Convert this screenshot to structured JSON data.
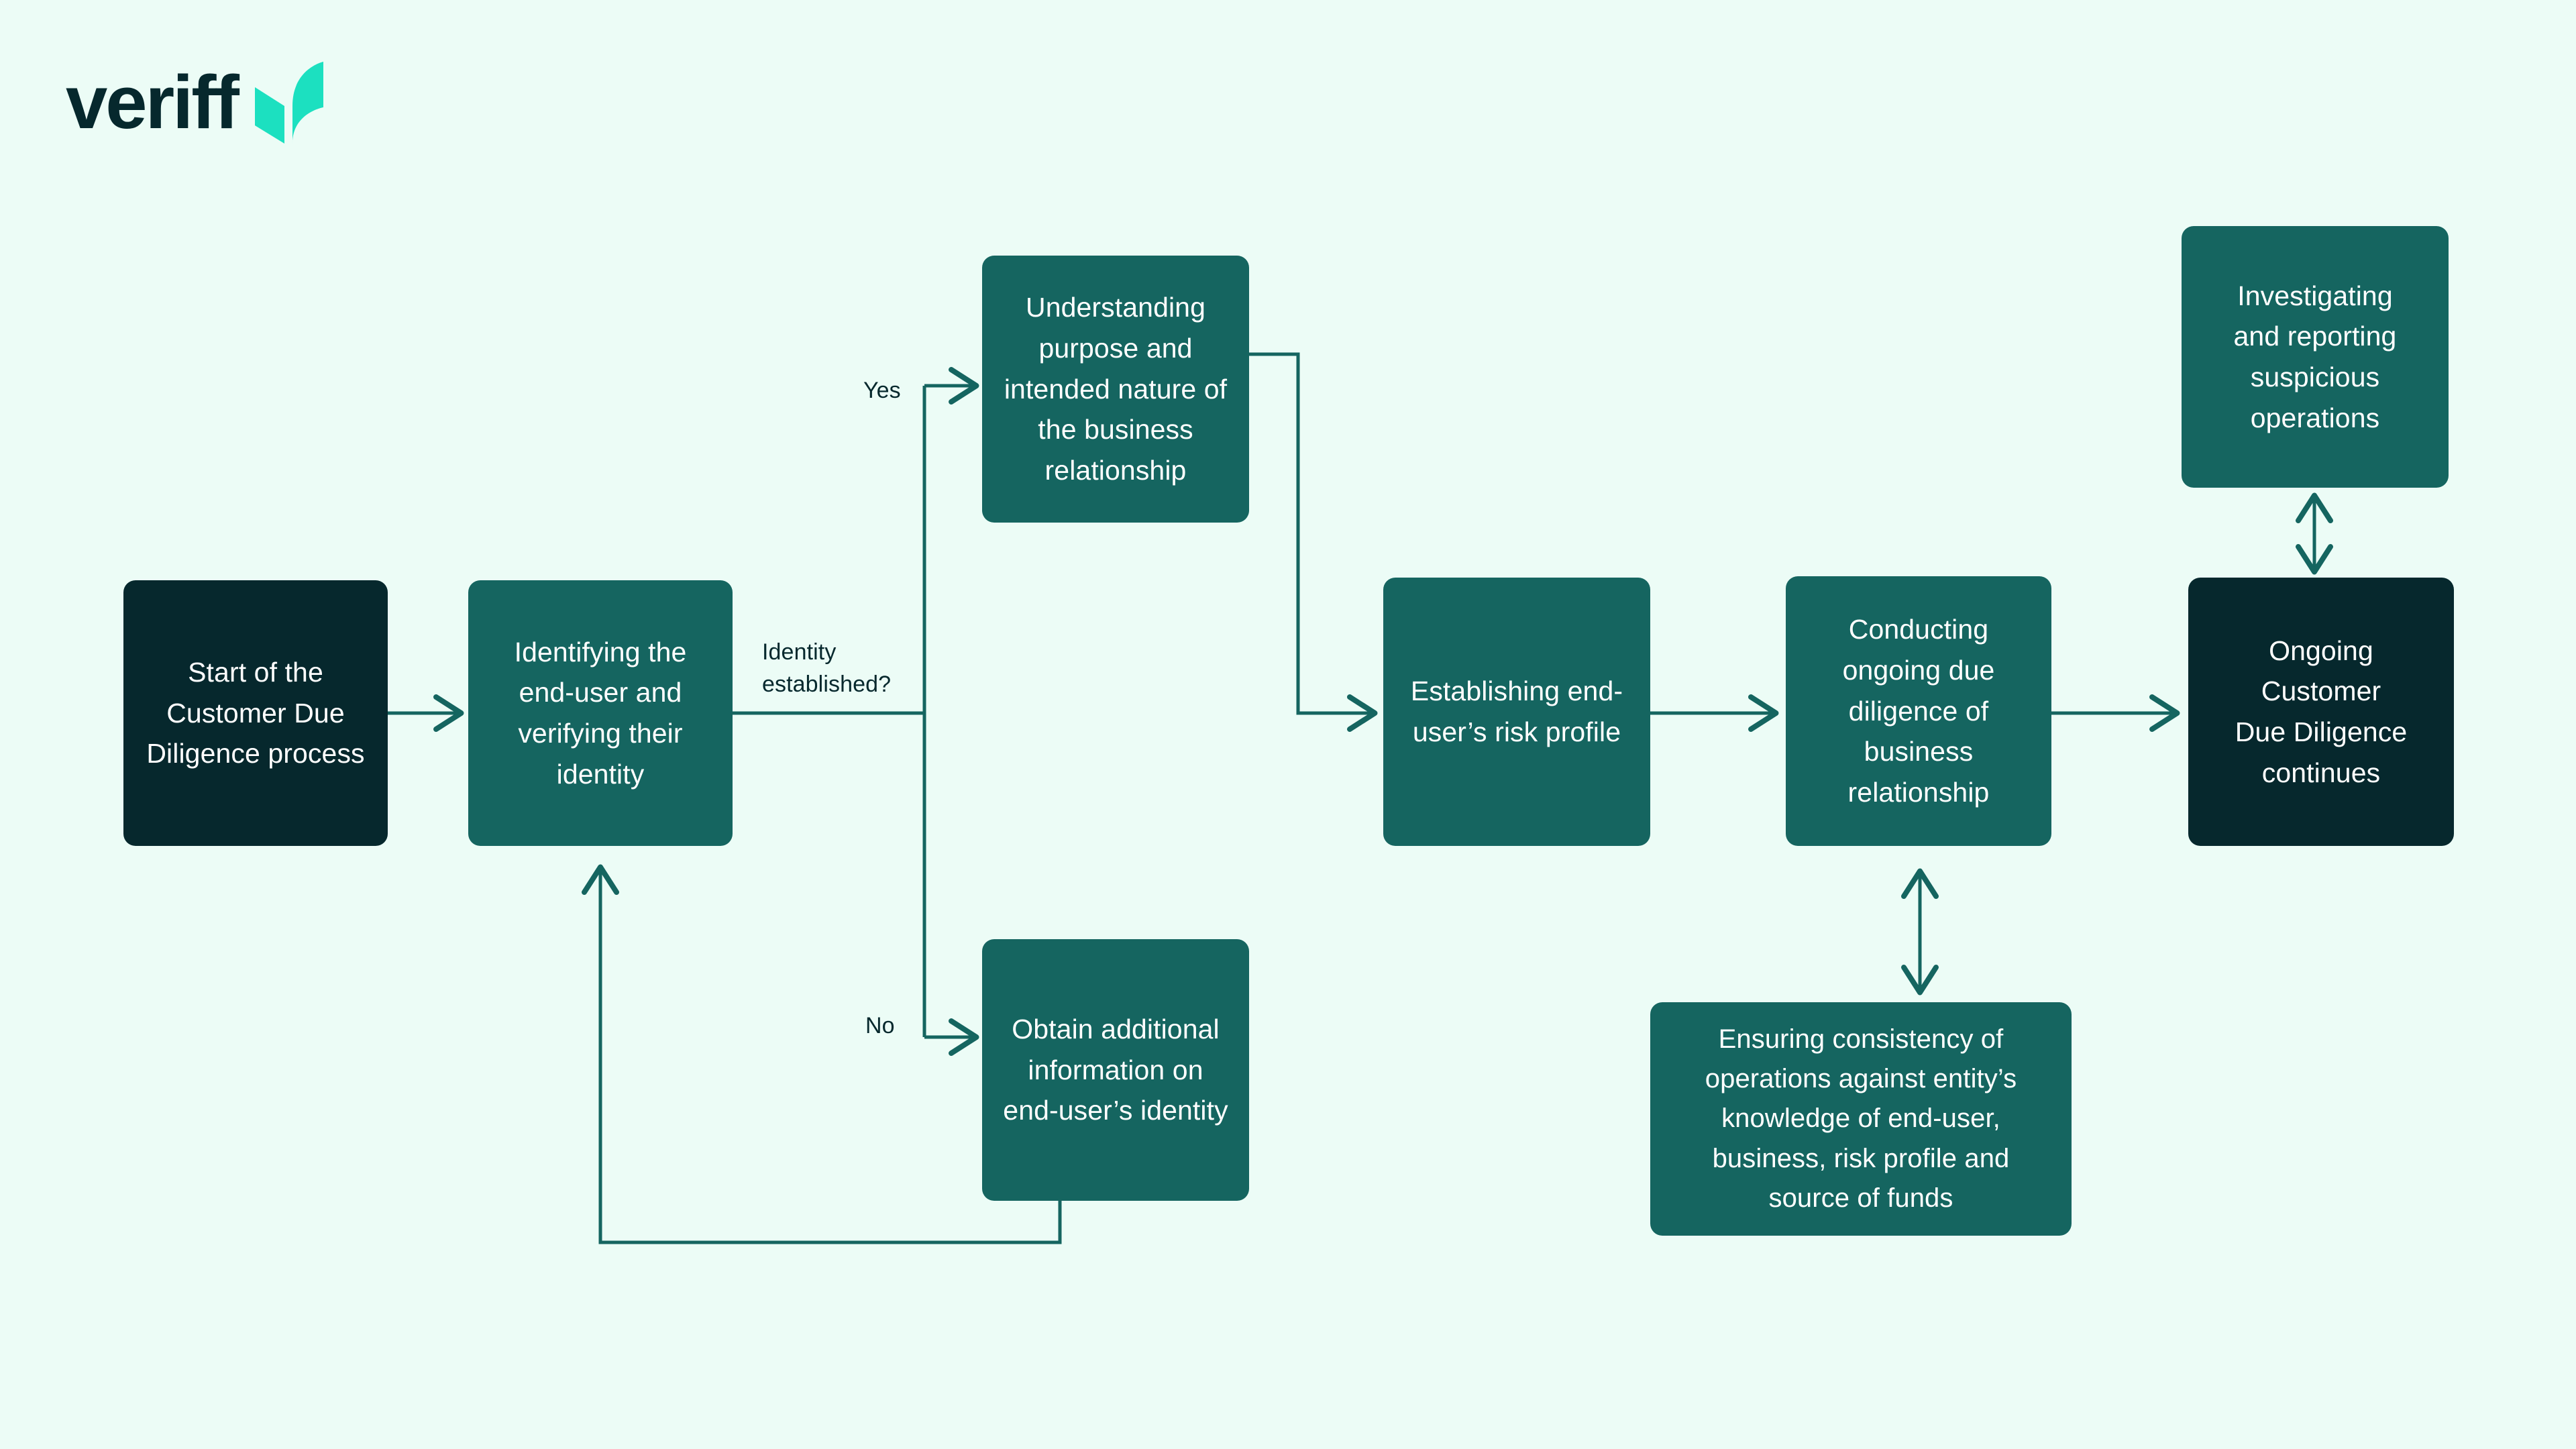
{
  "brand": {
    "name": "veriff",
    "logo_mark_name": "veriff-leaf-mark",
    "word_color": "#06282d",
    "mark_color": "#1ce0c0"
  },
  "canvas": {
    "background": "#ecfcf6",
    "node_dark_color": "#06282d",
    "node_teal_color": "#156560",
    "edge_color": "#156560",
    "node_text_color": "#ffffff",
    "label_text_color": "#06282d"
  },
  "diagram": {
    "title": "Customer Due Diligence process flowchart",
    "nodes": [
      {
        "id": "start",
        "label": "Start of the\nCustomer Due\nDiligence process",
        "style": "dark"
      },
      {
        "id": "identify",
        "label": "Identifying the\nend-user and\nverifying their\nidentity",
        "style": "teal"
      },
      {
        "id": "understand",
        "label": "Understanding\npurpose and\nintended nature of\nthe business\nrelationship",
        "style": "teal"
      },
      {
        "id": "obtain",
        "label": "Obtain additional\ninformation on\nend-user’s identity",
        "style": "teal"
      },
      {
        "id": "risk",
        "label": "Establishing end-\nuser’s risk profile",
        "style": "teal"
      },
      {
        "id": "ongoing",
        "label": "Conducting\nongoing due\ndiligence of\nbusiness\nrelationship",
        "style": "teal"
      },
      {
        "id": "continues",
        "label": "Ongoing Customer\nDue Diligence\ncontinues",
        "style": "dark"
      },
      {
        "id": "investigate",
        "label": "Investigating\nand reporting\nsuspicious\noperations",
        "style": "teal"
      },
      {
        "id": "consistency",
        "label": "Ensuring consistency of\noperations against   entity’s\nknowledge of end-user,\nbusiness, risk profile and\nsource of funds",
        "style": "teal"
      }
    ],
    "edge_labels": [
      {
        "id": "decision",
        "text": "Identity\nestablished?"
      },
      {
        "id": "yes",
        "text": "Yes"
      },
      {
        "id": "no",
        "text": "No"
      }
    ]
  }
}
